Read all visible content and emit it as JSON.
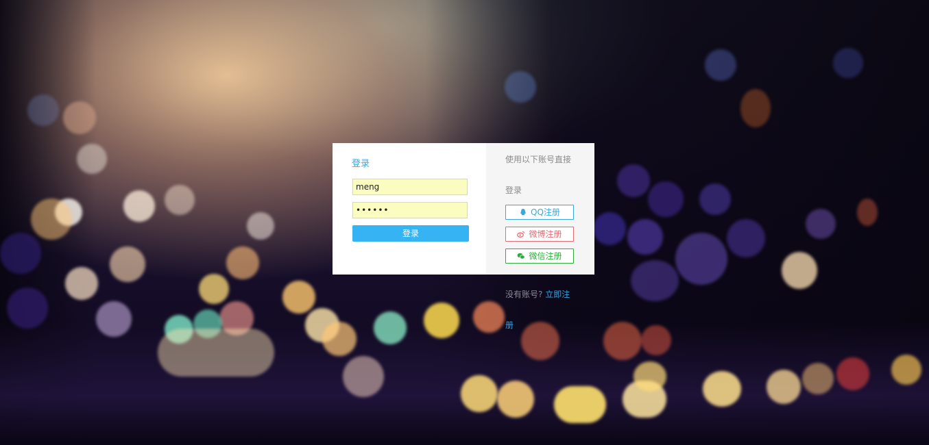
{
  "login": {
    "title": "登录",
    "username_value": "meng",
    "password_value": "••••••",
    "submit_label": "登录"
  },
  "social": {
    "intro_line1": "使用以下账号直接",
    "intro_line2": "登录",
    "buttons": [
      {
        "label": "QQ注册",
        "icon": "qq-icon",
        "color": "#37a8dd"
      },
      {
        "label": "微博注册",
        "icon": "weibo-icon",
        "color": "#e36a72"
      },
      {
        "label": "微信注册",
        "icon": "wechat-icon",
        "color": "#2aae38"
      }
    ]
  },
  "register": {
    "prompt": "没有账号?",
    "link_label": "立即注册"
  },
  "colors": {
    "accent": "#35b3f2",
    "link": "#3aa6e0"
  }
}
